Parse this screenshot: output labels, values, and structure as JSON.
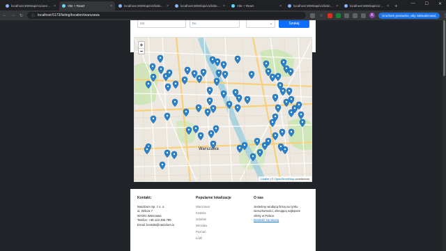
{
  "browser": {
    "tabs": [
      {
        "title": "localhost:3000/api/v1/users/l/l",
        "icon": "globe-icon",
        "active": false
      },
      {
        "title": "Vite + React",
        "icon": "react-icon",
        "active": true
      },
      {
        "title": "localhost:3000/api/v1/listings/",
        "icon": "globe-icon",
        "active": false
      },
      {
        "title": "localhost:3000/api/v1/listings/",
        "icon": "globe-icon",
        "active": false
      },
      {
        "title": "Vite + React",
        "icon": "react-icon",
        "active": false
      },
      {
        "title": "localhost:3000/api/v1/listings/",
        "icon": "globe-icon",
        "active": false
      },
      {
        "title": "localhost:3000/api/v1/data/cou",
        "icon": "globe-icon",
        "active": false
      }
    ],
    "new_tab": "+",
    "url": "localhost:5173/listing/location/warszawa",
    "sync_label": "Uruchom ponownie, aby zaktualizować",
    "profile_letter": "K"
  },
  "filters": {
    "from_placeholder": "Od",
    "to_placeholder": "Do",
    "search_label": "Szukaj"
  },
  "map": {
    "zoom_in": "+",
    "zoom_out": "−",
    "city_label": "Warszawa",
    "attribution_leaflet": "Leaflet",
    "attribution_sep": " | © ",
    "attribution_osm": "OpenStreetMap",
    "attribution_suffix": " contributors",
    "pin_color": "#2a81cb"
  },
  "footer": {
    "contact": {
      "heading": "Kontakt:",
      "lines": [
        "NaszDom Sp. z o. o.",
        "ul. Wilcza 7",
        "00-001 Warszawa",
        "Telefon: +48 123 456 789",
        "Email: kontakt@naszdom.io"
      ]
    },
    "locations": {
      "heading": "Popularne lokalizacje",
      "items": [
        "Warszawa",
        "Kraków",
        "Gdańsk",
        "Wrocław",
        "Poznań",
        "Łódź"
      ]
    },
    "about": {
      "heading": "O nas",
      "text_lines": [
        "Jesteśmy wiodącą firmą na rynku",
        "nieruchomości, oferującą najlepsze",
        "oferty w Polsce."
      ],
      "link": "Dowiedz się więcej"
    }
  }
}
